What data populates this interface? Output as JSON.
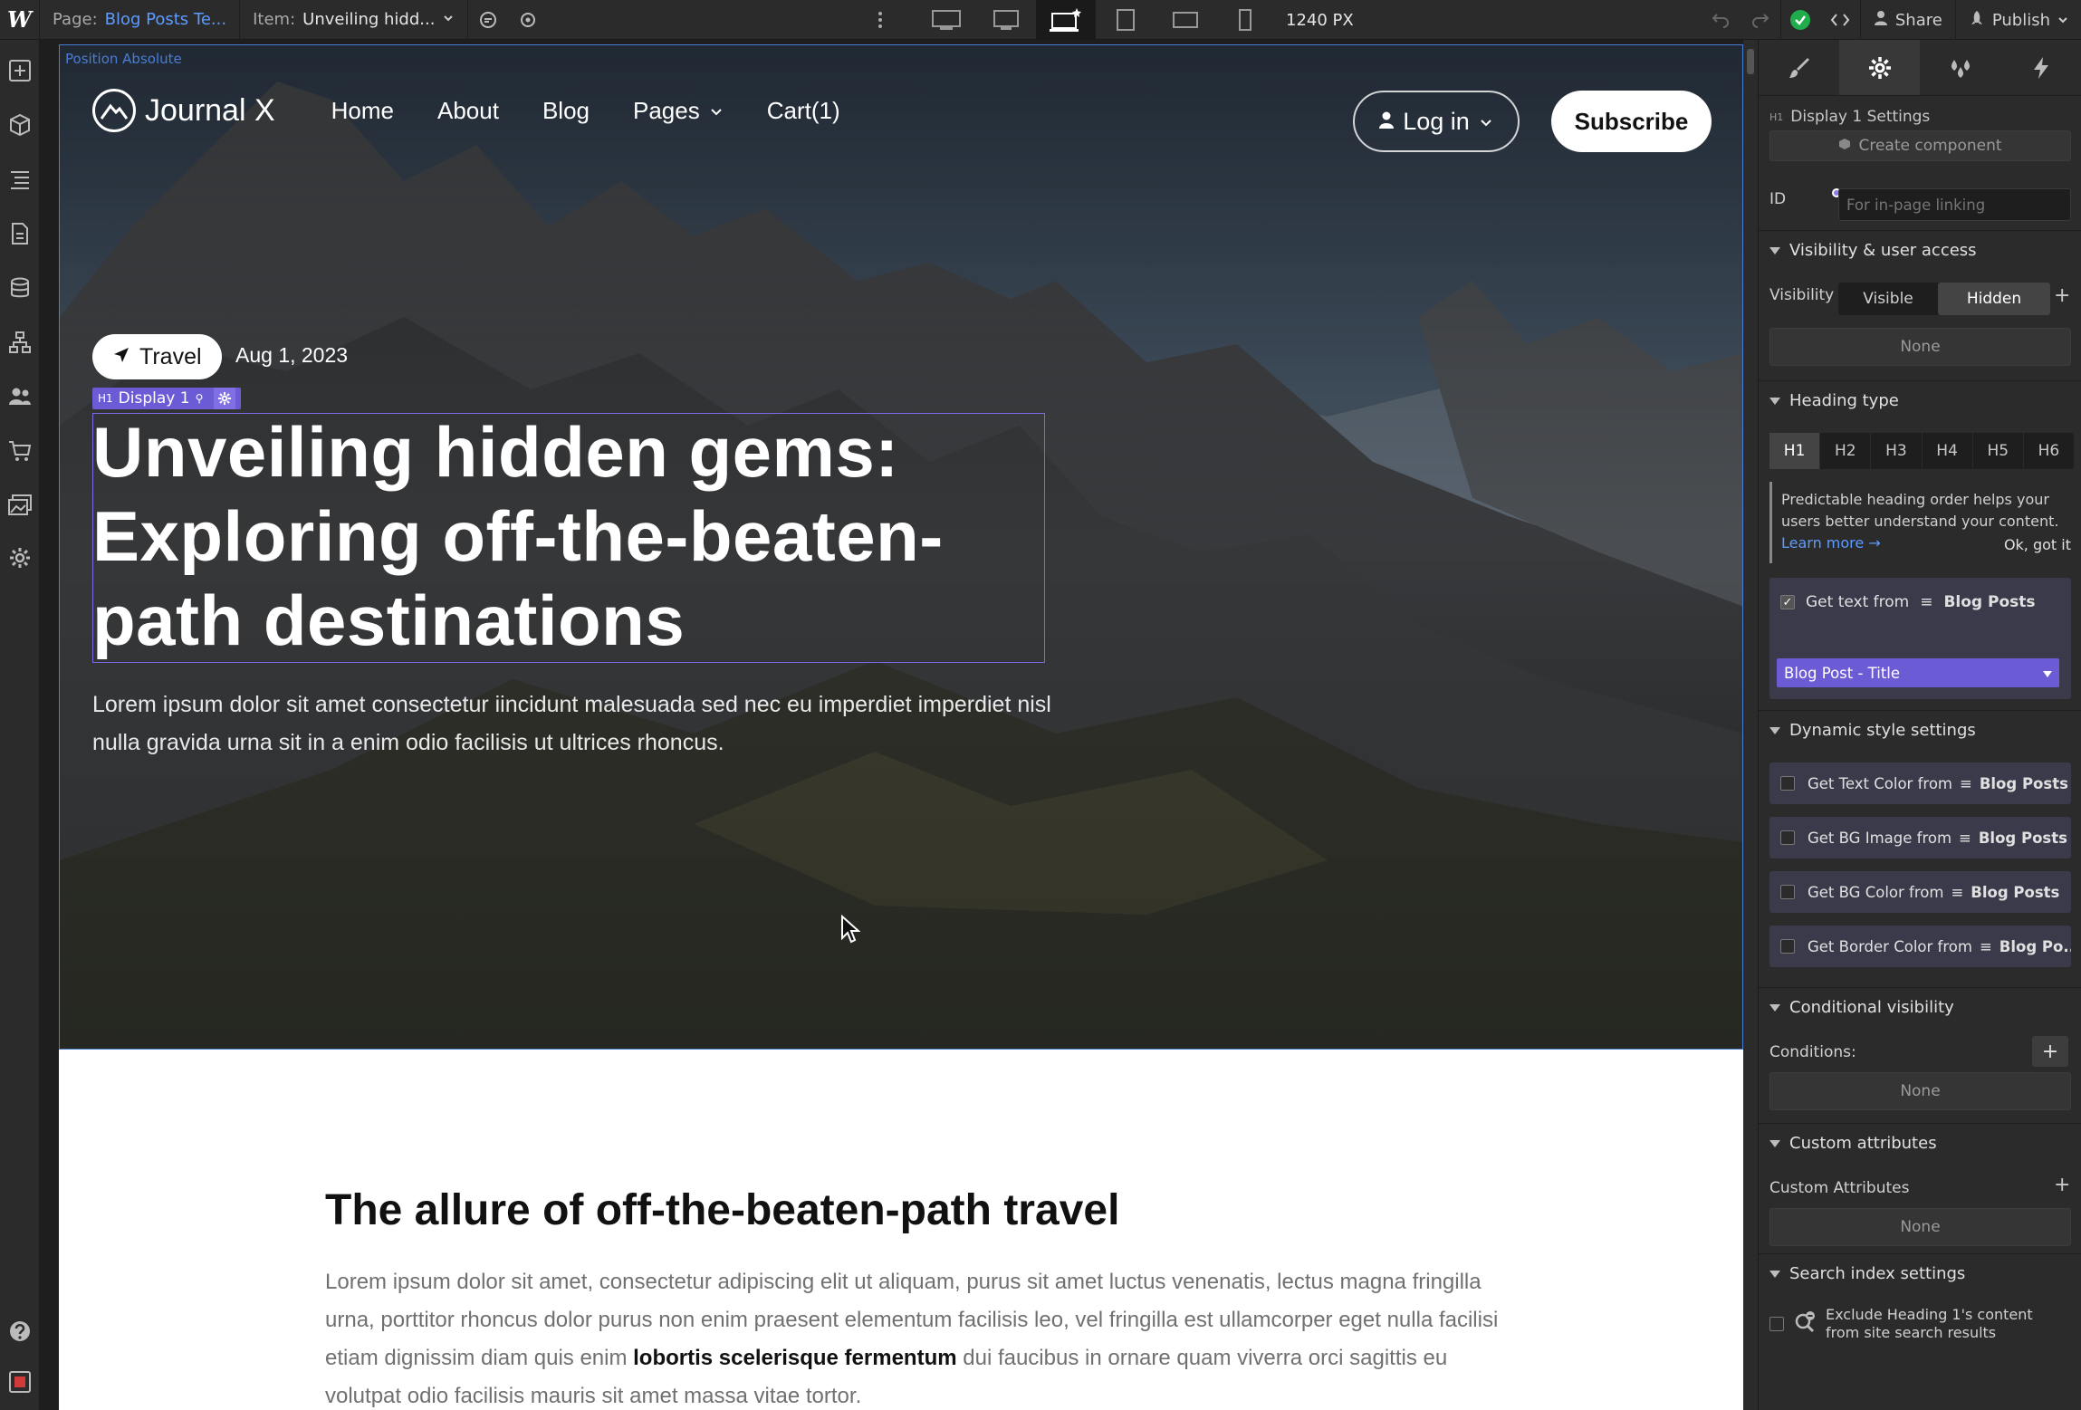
{
  "topbar": {
    "page_label": "Page:",
    "page_value": "Blog Posts Te...",
    "item_label": "Item:",
    "item_value": "Unveiling hidd...",
    "width": "1240 PX",
    "share": "Share",
    "publish": "Publish"
  },
  "canvas": {
    "position_label": "Position Absolute",
    "brand": "Journal X",
    "nav": [
      "Home",
      "About",
      "Blog",
      "Pages",
      "Cart(1)"
    ],
    "login": "Log in",
    "subscribe": "Subscribe",
    "tag": "Travel",
    "date": "Aug 1, 2023",
    "selection_label": "Display 1",
    "headline_1": "Unveiling hidden gems:",
    "headline_2": "Exploring off-the-beaten-",
    "headline_3": "path destinations",
    "hero_desc": "Lorem ipsum dolor sit amet consectetur iincidunt malesuada sed nec eu imperdiet imperdiet nisl nulla gravida urna sit in a enim odio facilisis ut ultrices rhoncus.",
    "section_title": "The allure of off-the-beaten-path travel",
    "body_before": "Lorem ipsum dolor sit amet, consectetur adipiscing elit ut aliquam, purus sit amet luctus venenatis, lectus magna fringilla urna, porttitor rhoncus dolor purus non enim praesent elementum facilisis leo, vel fringilla est ullamcorper eget nulla facilisi etiam dignissim diam quis enim",
    "body_bold": "lobortis scelerisque fermentum",
    "body_after": "dui faucibus in ornare quam viverra orci sagittis eu volutpat odio facilisis mauris sit amet massa vitae tortor."
  },
  "panel": {
    "element_title": "Display 1 Settings",
    "create_component": "Create component",
    "id_label": "ID",
    "id_placeholder": "For in-page linking",
    "visibility_section": "Visibility & user access",
    "visibility_label": "Visibility",
    "visible": "Visible",
    "hidden": "Hidden",
    "none": "None",
    "heading_type_section": "Heading type",
    "headings": [
      "H1",
      "H2",
      "H3",
      "H4",
      "H5",
      "H6"
    ],
    "hint_text": "Predictable heading order helps your users better understand your content.",
    "learn_more": "Learn more →",
    "ok_got_it": "Ok, got it",
    "get_text_from": "Get text from",
    "blog_posts": "Blog Posts",
    "field_select": "Blog Post - Title",
    "dynamic_section": "Dynamic style settings",
    "dyn_text_color": "Get Text Color from",
    "dyn_bg_image": "Get BG Image from",
    "dyn_bg_color": "Get BG Color from",
    "dyn_border_color": "Get Border Color from",
    "blog_po_short": "Blog Po...",
    "conditional_section": "Conditional visibility",
    "conditions_label": "Conditions:",
    "custom_attr_section": "Custom attributes",
    "custom_attr_label": "Custom Attributes",
    "search_section": "Search index settings",
    "exclude_line1": "Exclude Heading 1's content",
    "exclude_line2": "from site search results"
  }
}
